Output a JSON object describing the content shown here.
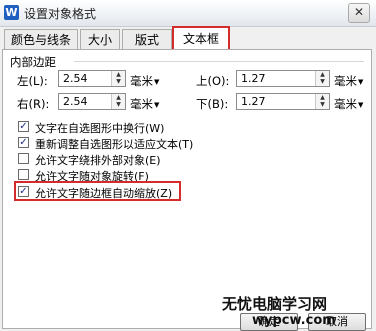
{
  "window": {
    "title": "设置对象格式",
    "app_icon": "W",
    "close_symbol": "✕"
  },
  "tabs": [
    "颜色与线条",
    "大小",
    "版式",
    "文本框"
  ],
  "section": {
    "title": "内部边距"
  },
  "margins": {
    "left": {
      "label": "左(L):",
      "value": "2.54"
    },
    "top": {
      "label": "上(O):",
      "value": "1.27"
    },
    "right": {
      "label": "右(R):",
      "value": "2.54"
    },
    "bottom": {
      "label": "下(B):",
      "value": "1.27"
    },
    "unit": "毫米"
  },
  "options": [
    {
      "label": "文字在自选图形中换行(W)",
      "checked": true
    },
    {
      "label": "重新调整自选图形以适应文本(T)",
      "checked": true
    },
    {
      "label": "允许文字绕排外部对象(E)",
      "checked": false
    },
    {
      "label": "允许文字随对象旋转(F)",
      "checked": false
    },
    {
      "label": "允许文字随边框自动缩放(Z)",
      "checked": true
    }
  ],
  "watermark": {
    "line1": "无忧电脑学习网",
    "line2": "wypcw.com"
  },
  "buttons": {
    "ok": "确定",
    "cancel": "取消"
  },
  "colors": {
    "highlight": "#d42b2b"
  }
}
